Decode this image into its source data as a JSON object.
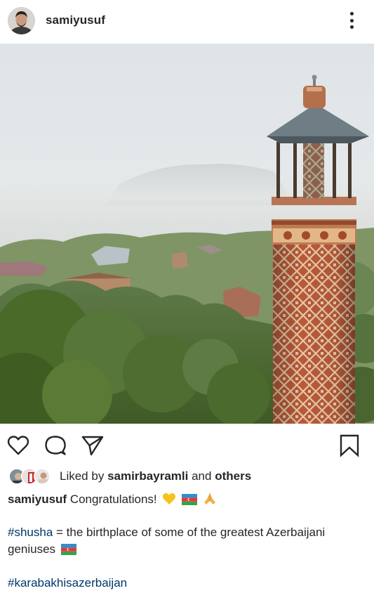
{
  "post": {
    "username": "samiyusuf",
    "likes": {
      "prefix": "Liked by",
      "user": "samirbayramli",
      "joiner": "and",
      "others": "others"
    },
    "caption": {
      "username": "samiyusuf",
      "text": "Congratulations!",
      "emojis": [
        "yellow-heart",
        "azerbaijan-flag",
        "folded-hands"
      ],
      "hashtag1": "#shusha",
      "line1": " = the birthplace of some of the greatest Azerbaijani geniuses",
      "hashtag2": "#karabakhisazerbaijan"
    }
  },
  "icons": {
    "like": "heart-outline-icon",
    "comment": "comment-bubble-icon",
    "share": "paper-plane-icon",
    "save": "bookmark-icon",
    "more": "vertical-dots-icon"
  },
  "colors": {
    "text": "#262626",
    "hashtag": "#00376b",
    "background": "#ffffff"
  }
}
